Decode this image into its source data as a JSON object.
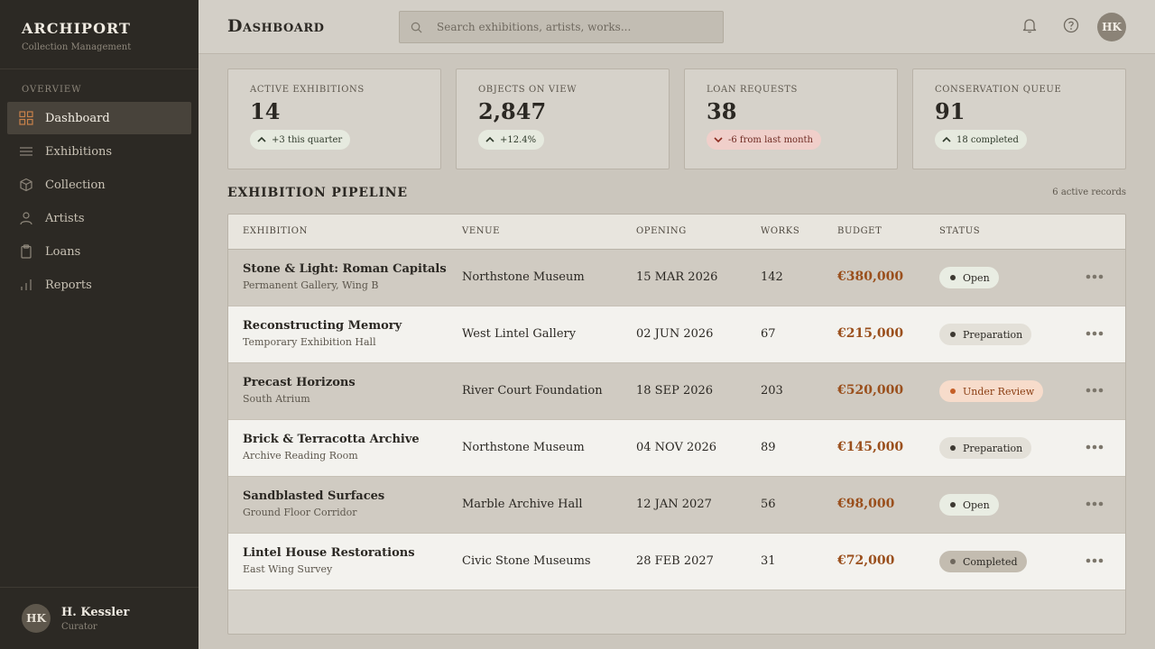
{
  "sidebar": {
    "brand": "ARCHIPORT",
    "brand_sub": "Collection Management",
    "section_label": "OVERVIEW",
    "items": [
      {
        "label": "Dashboard",
        "icon": "grid-icon",
        "active": true
      },
      {
        "label": "Exhibitions",
        "icon": "list-icon"
      },
      {
        "label": "Collection",
        "icon": "cube-icon"
      },
      {
        "label": "Artists",
        "icon": "user-icon"
      },
      {
        "label": "Loans",
        "icon": "clipboard-icon"
      },
      {
        "label": "Reports",
        "icon": "bar-chart-icon"
      }
    ],
    "user": {
      "initials": "HK",
      "name": "H. Kessler",
      "role": "Curator"
    }
  },
  "header": {
    "title": "Dashboard",
    "search_placeholder": "Search exhibitions, artists, works...",
    "avatar_initials": "HK"
  },
  "stats": [
    {
      "label": "Active Exhibitions",
      "value": "14",
      "change": "+3 this quarter",
      "trend": "up"
    },
    {
      "label": "Objects on View",
      "value": "2,847",
      "change": "+12.4%",
      "trend": "up"
    },
    {
      "label": "Loan Requests",
      "value": "38",
      "change": "-6 from last month",
      "trend": "down"
    },
    {
      "label": "Conservation Queue",
      "value": "91",
      "change": "18 completed",
      "trend": "up"
    }
  ],
  "pipeline": {
    "title": "Exhibition Pipeline",
    "meta": "6 active records",
    "columns": [
      "Exhibition",
      "Venue",
      "Opening",
      "Works",
      "Budget",
      "Status"
    ],
    "rows": [
      {
        "title": "Stone & Light: Roman Capitals",
        "location": "Permanent Gallery, Wing B",
        "venue": "Northstone Museum",
        "opening": "15 MAR 2026",
        "works": "142",
        "budget": "€380,000",
        "status": "Open"
      },
      {
        "title": "Reconstructing Memory",
        "location": "Temporary Exhibition Hall",
        "venue": "West Lintel Gallery",
        "opening": "02 JUN 2026",
        "works": "67",
        "budget": "€215,000",
        "status": "Preparation"
      },
      {
        "title": "Precast Horizons",
        "location": "South Atrium",
        "venue": "River Court Foundation",
        "opening": "18 SEP 2026",
        "works": "203",
        "budget": "€520,000",
        "status": "Under Review"
      },
      {
        "title": "Brick & Terracotta Archive",
        "location": "Archive Reading Room",
        "venue": "Northstone Museum",
        "opening": "04 NOV 2026",
        "works": "89",
        "budget": "€145,000",
        "status": "Preparation"
      },
      {
        "title": "Sandblasted Surfaces",
        "location": "Ground Floor Corridor",
        "venue": "Marble Archive Hall",
        "opening": "12 JAN 2027",
        "works": "56",
        "budget": "€98,000",
        "status": "Open"
      },
      {
        "title": "Lintel House Restorations",
        "location": "East Wing Survey",
        "venue": "Civic Stone Museums",
        "opening": "28 FEB 2027",
        "works": "31",
        "budget": "€72,000",
        "status": "Completed"
      }
    ]
  },
  "colors": {
    "sidebar_bg": "#2c2924",
    "accent_budget": "#9a4f1c",
    "review_bg": "#f7dccb",
    "down_bg": "#f0cfca"
  }
}
